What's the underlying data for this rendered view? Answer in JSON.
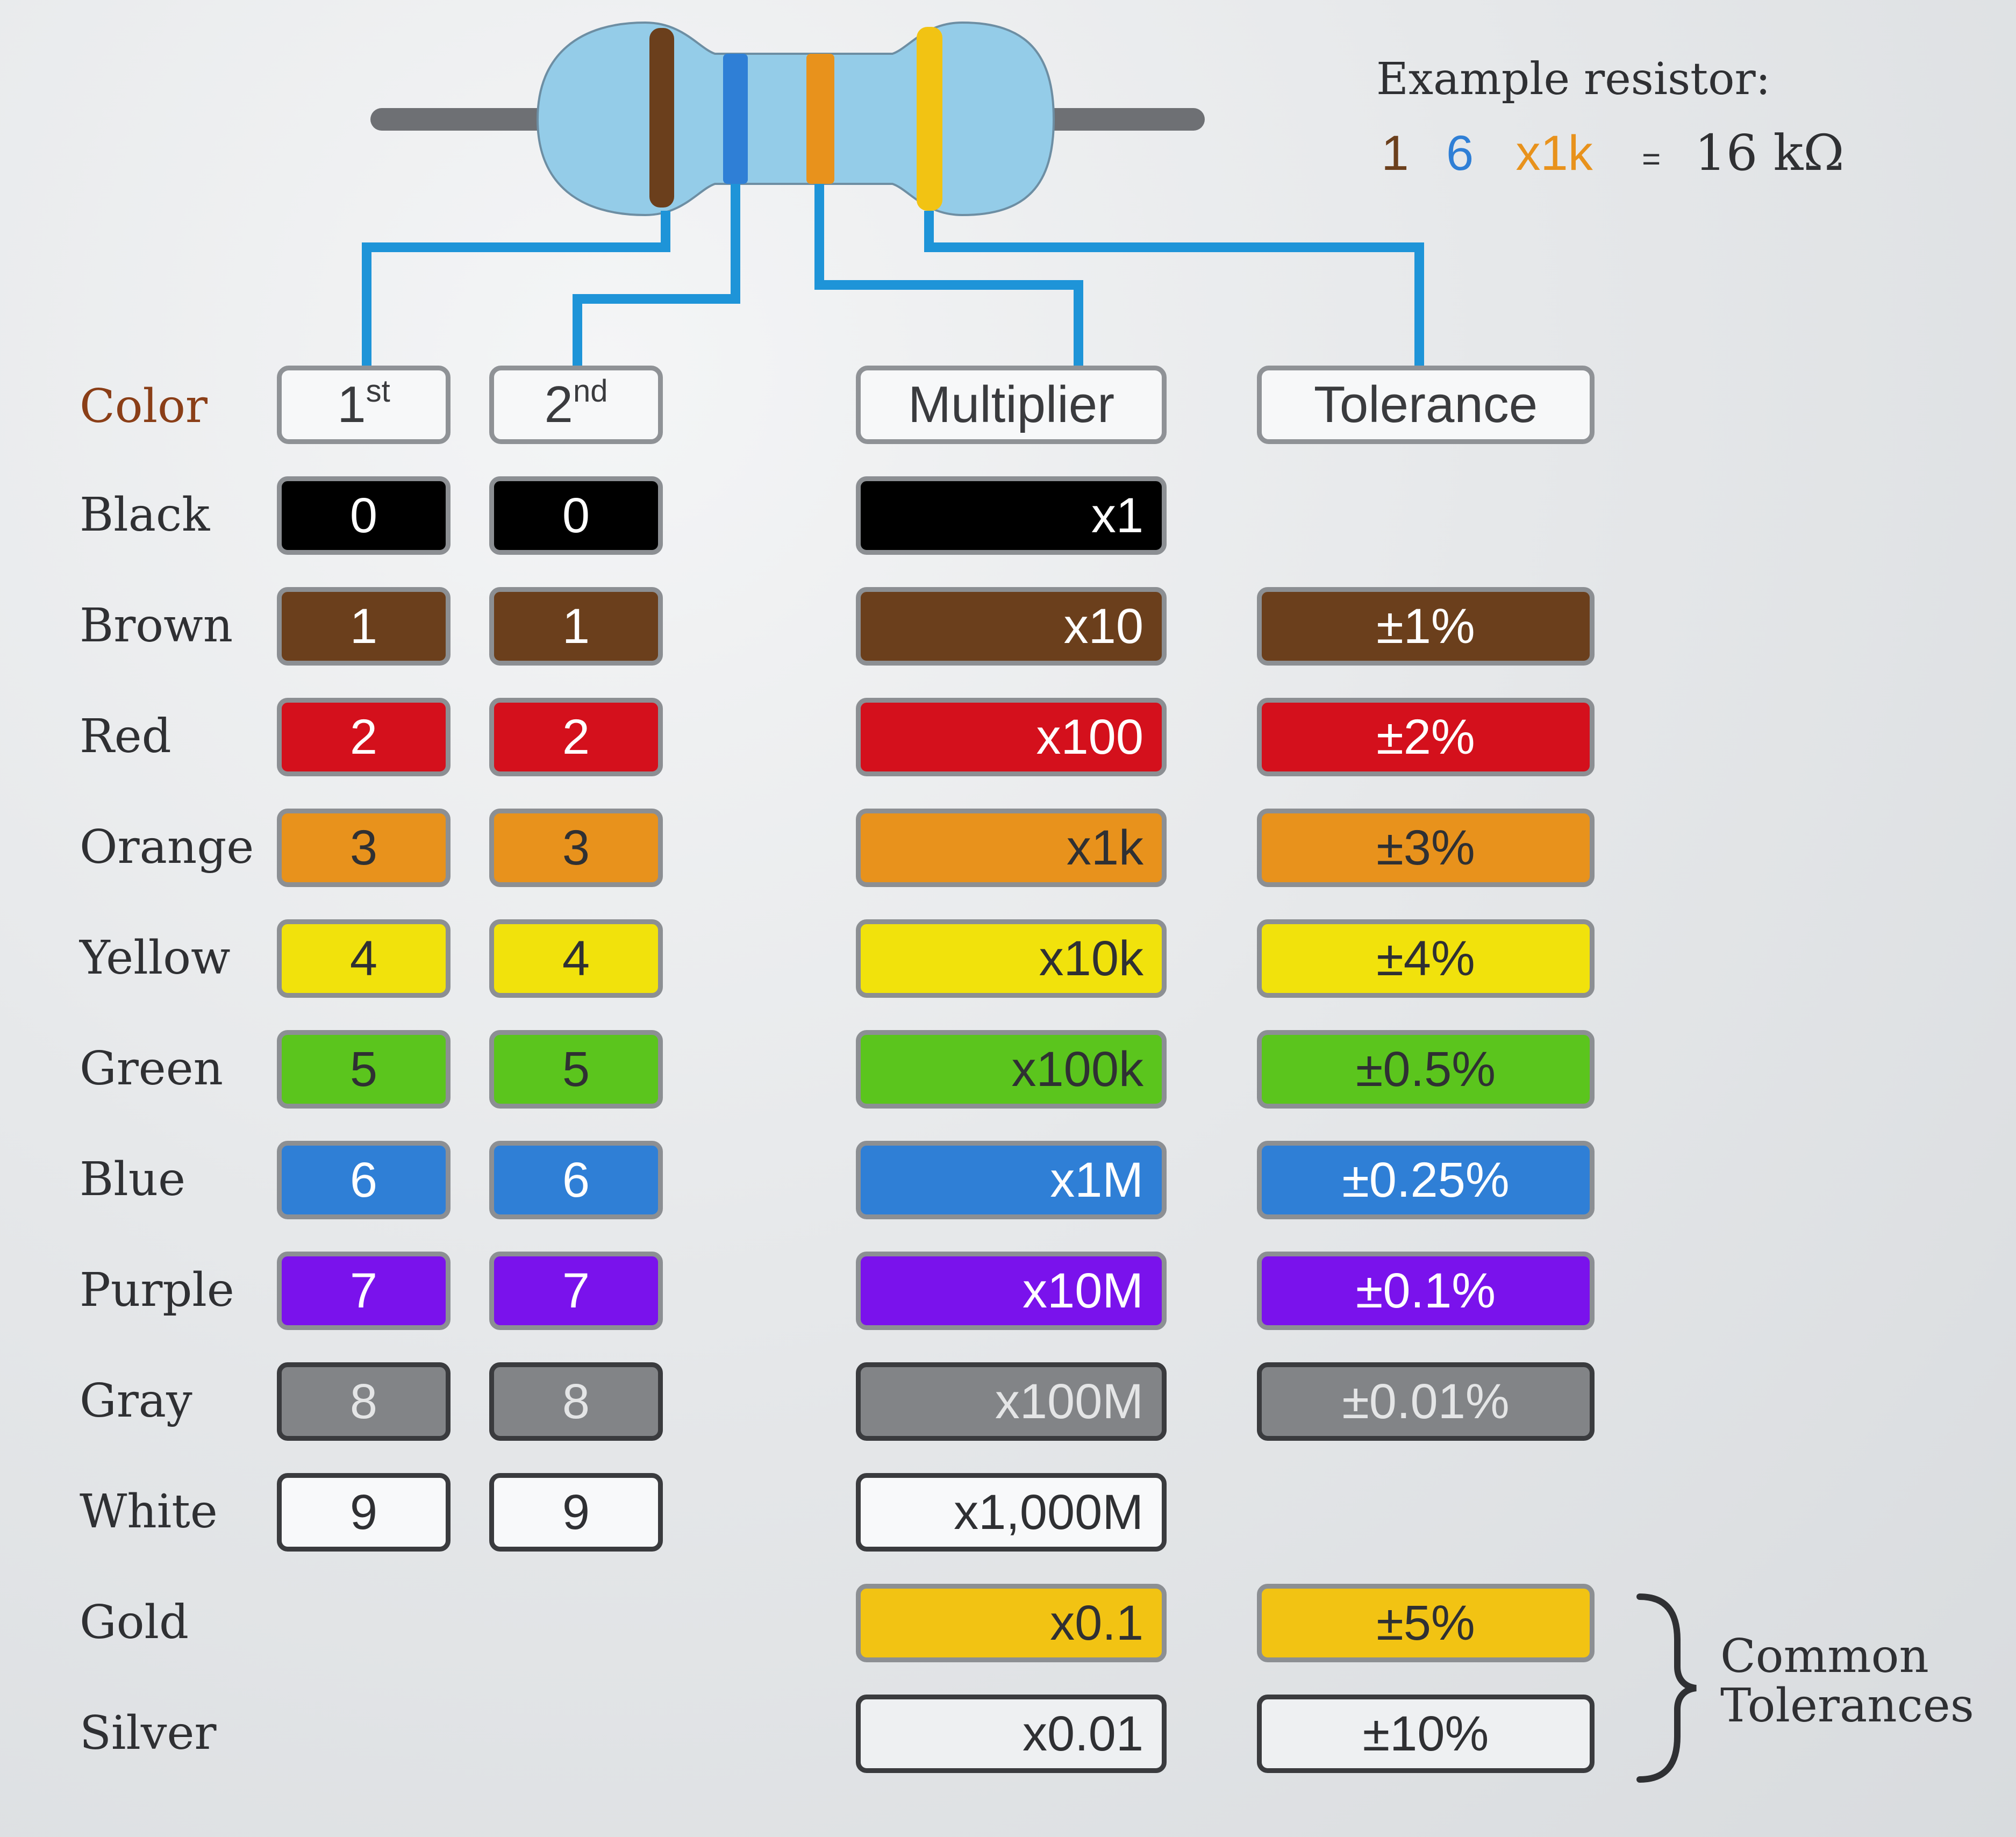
{
  "example": {
    "title": "Example resistor:",
    "digit1": "1",
    "digit2": "6",
    "multiplier": "x1k",
    "equals": "=",
    "result": "16 kΩ",
    "colors": {
      "digit1": "#6b3f1c",
      "digit2": "#2f7fd6",
      "multiplier": "#e8921c"
    }
  },
  "resistor": {
    "bands": [
      "#6b3f1c",
      "#2f7fd6",
      "#e8921c",
      "#f2c313"
    ],
    "body_color": "#94cce8",
    "lead_color": "#6e7074",
    "connector_color": "#1e94d8"
  },
  "headers": {
    "color_label": "Color",
    "first": "1",
    "first_sup": "st",
    "second": "2",
    "second_sup": "nd",
    "multiplier": "Multiplier",
    "tolerance": "Tolerance"
  },
  "rows": [
    {
      "name": "Black",
      "bg": "#000000",
      "fg": "#ffffff",
      "d1": "0",
      "d2": "0",
      "mult": "x1",
      "tol": ""
    },
    {
      "name": "Brown",
      "bg": "#6b3f1c",
      "fg": "#ffffff",
      "d1": "1",
      "d2": "1",
      "mult": "x10",
      "tol": "±1%"
    },
    {
      "name": "Red",
      "bg": "#d4101c",
      "fg": "#ffffff",
      "d1": "2",
      "d2": "2",
      "mult": "x100",
      "tol": "±2%"
    },
    {
      "name": "Orange",
      "bg": "#e8921c",
      "fg": "#2f3033",
      "d1": "3",
      "d2": "3",
      "mult": "x1k",
      "tol": "±3%"
    },
    {
      "name": "Yellow",
      "bg": "#f1e20c",
      "fg": "#2f3033",
      "d1": "4",
      "d2": "4",
      "mult": "x10k",
      "tol": "±4%"
    },
    {
      "name": "Green",
      "bg": "#5bc51d",
      "fg": "#2f3033",
      "d1": "5",
      "d2": "5",
      "mult": "x100k",
      "tol": "±0.5%"
    },
    {
      "name": "Blue",
      "bg": "#2f7fd6",
      "fg": "#ffffff",
      "d1": "6",
      "d2": "6",
      "mult": "x1M",
      "tol": "±0.25%"
    },
    {
      "name": "Purple",
      "bg": "#7a12ec",
      "fg": "#ffffff",
      "d1": "7",
      "d2": "7",
      "mult": "x10M",
      "tol": "±0.1%"
    },
    {
      "name": "Gray",
      "bg": "#828487",
      "fg": "#e4e5e6",
      "d1": "8",
      "d2": "8",
      "mult": "x100M",
      "tol": "±0.01%"
    },
    {
      "name": "White",
      "bg": "#f8f9fa",
      "fg": "#2f3033",
      "d1": "9",
      "d2": "9",
      "mult": "x1,000M",
      "tol": ""
    },
    {
      "name": "Gold",
      "bg": "#f2c313",
      "fg": "#2f3033",
      "d1": "",
      "d2": "",
      "mult": "x0.1",
      "tol": "±5%"
    },
    {
      "name": "Silver",
      "bg": "#eef0f2",
      "fg": "#2f3033",
      "d1": "",
      "d2": "",
      "mult": "x0.01",
      "tol": "±10%"
    }
  ],
  "common_tolerances": {
    "line1": "Common",
    "line2": "Tolerances"
  }
}
